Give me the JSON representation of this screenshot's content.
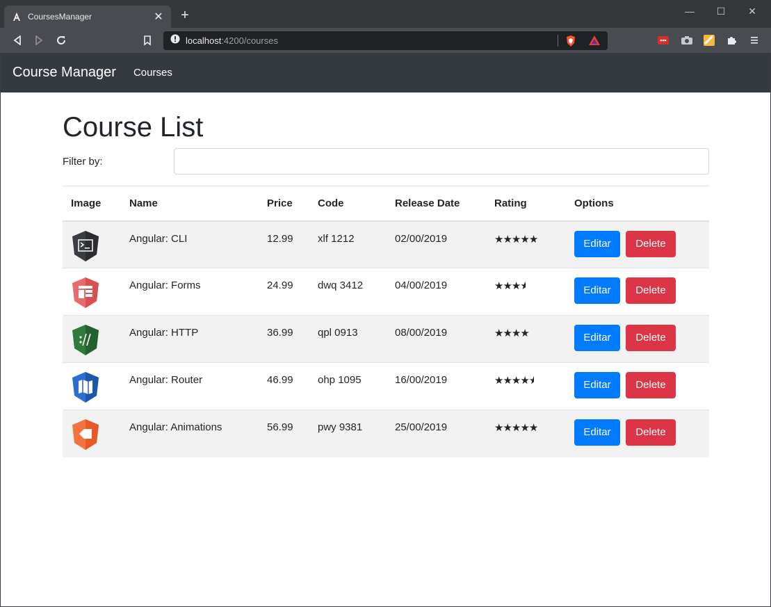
{
  "browser": {
    "tab_title": "CoursesManager",
    "url_host": "localhost",
    "url_path": ":4200/courses"
  },
  "navbar": {
    "brand": "Course Manager",
    "links": [
      "Courses"
    ]
  },
  "page": {
    "heading": "Course List",
    "filter_label": "Filter by:",
    "filter_value": ""
  },
  "table": {
    "headers": [
      "Image",
      "Name",
      "Price",
      "Code",
      "Release Date",
      "Rating",
      "Options"
    ],
    "rows": [
      {
        "name": "Angular: CLI",
        "price": "12.99",
        "code": "xlf 1212",
        "release_date": "02/00/2019",
        "rating": 5,
        "icon": "cli-icon",
        "icon_color": "#3a3d42"
      },
      {
        "name": "Angular: Forms",
        "price": "24.99",
        "code": "dwq 3412",
        "release_date": "04/00/2019",
        "rating": 3.5,
        "icon": "forms-icon",
        "icon_color": "#e05a5a"
      },
      {
        "name": "Angular: HTTP",
        "price": "36.99",
        "code": "qpl 0913",
        "release_date": "08/00/2019",
        "rating": 4,
        "icon": "http-icon",
        "icon_color": "#2a6e35"
      },
      {
        "name": "Angular: Router",
        "price": "46.99",
        "code": "ohp 1095",
        "release_date": "16/00/2019",
        "rating": 4.5,
        "icon": "router-icon",
        "icon_color": "#1f5fbf"
      },
      {
        "name": "Angular: Animations",
        "price": "56.99",
        "code": "pwy 9381",
        "release_date": "25/00/2019",
        "rating": 5,
        "icon": "animations-icon",
        "icon_color": "#f26633"
      }
    ],
    "edit_label": "Editar",
    "delete_label": "Delete"
  },
  "colors": {
    "navbar_bg": "#343a40",
    "edit_button": "#007bff",
    "delete_button": "#dc3545"
  }
}
